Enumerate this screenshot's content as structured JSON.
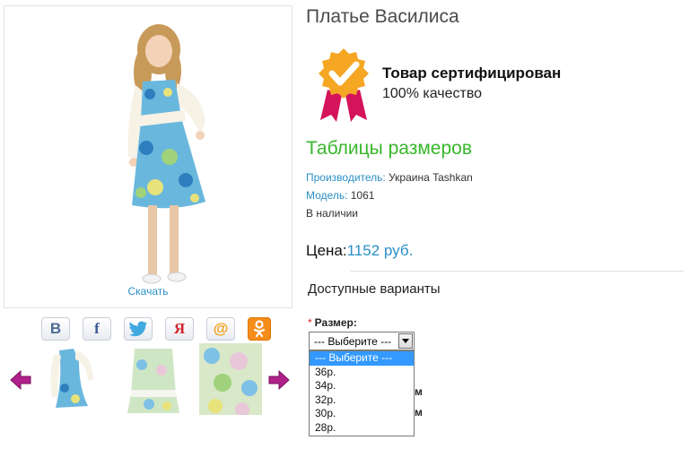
{
  "product": {
    "title": "Платье Василиса",
    "download_label": "Скачать"
  },
  "certificate": {
    "title": "Товар сертифицирован",
    "subtitle": "100% качество"
  },
  "sizes_link": "Таблицы размеров",
  "info": {
    "manufacturer_label": "Производитель:",
    "manufacturer_value": " Украина Tashkan",
    "model_label": "Модель:",
    "model_value": " 1061",
    "availability": "В наличии"
  },
  "price": {
    "label": "Цена:",
    "value": "1152 руб."
  },
  "options": {
    "heading": "Доступные варианты",
    "required_mark": "*",
    "size_label": "Размер:",
    "selected": "--- Выберите ---",
    "dropdown_items": [
      "--- Выберите ---",
      "36р.",
      "34р.",
      "32р.",
      "30р.",
      "28р."
    ],
    "behind_text_1": "м",
    "behind_text_2": "м"
  },
  "social": {
    "vk": "В",
    "facebook": "f",
    "yandex": "Я",
    "mail": "@",
    "ok": "ok"
  },
  "icons": {
    "medal": "certified-medal-icon",
    "prev": "arrow-left-icon",
    "next": "arrow-right-icon",
    "twitter": "twitter-bird-icon"
  },
  "colors": {
    "link_blue": "#2a8fc6",
    "green": "#38b62b",
    "dress_blue": "#3a9fd6",
    "arrow_purple": "#b0208a"
  }
}
